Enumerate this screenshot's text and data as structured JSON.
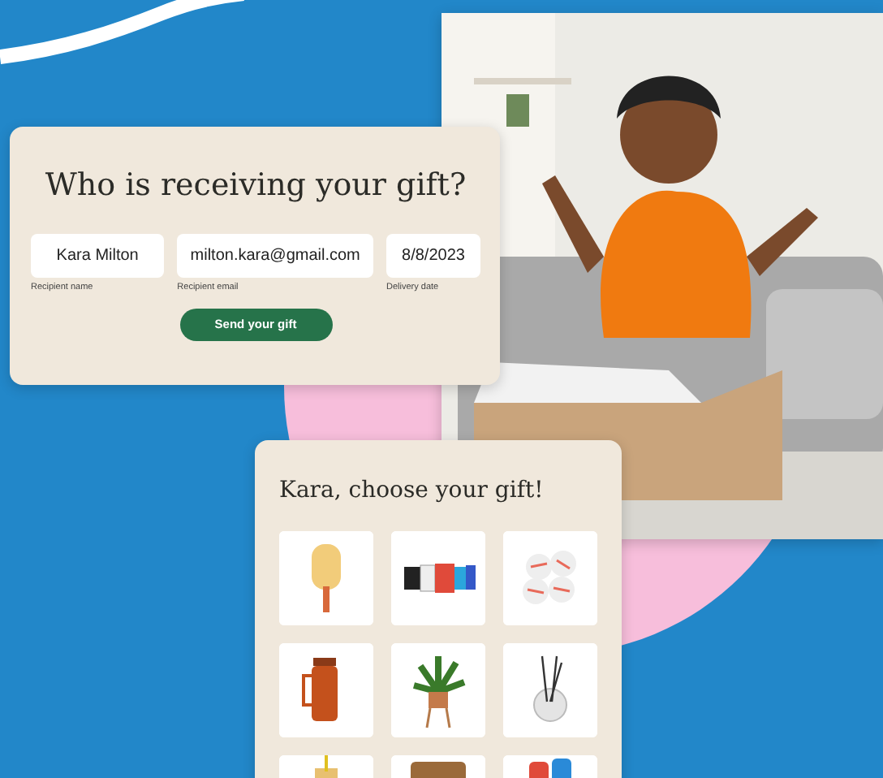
{
  "recipient_form": {
    "title": "Who is receiving your gift?",
    "fields": [
      {
        "value": "Kara Milton",
        "label": "Recipient name"
      },
      {
        "value": "milton.kara@gmail.com",
        "label": "Recipient email"
      },
      {
        "value": "8/8/2023",
        "label": "Delivery date"
      }
    ],
    "button": "Send your gift"
  },
  "gift_chooser": {
    "title": "Kara, choose your gift!"
  }
}
